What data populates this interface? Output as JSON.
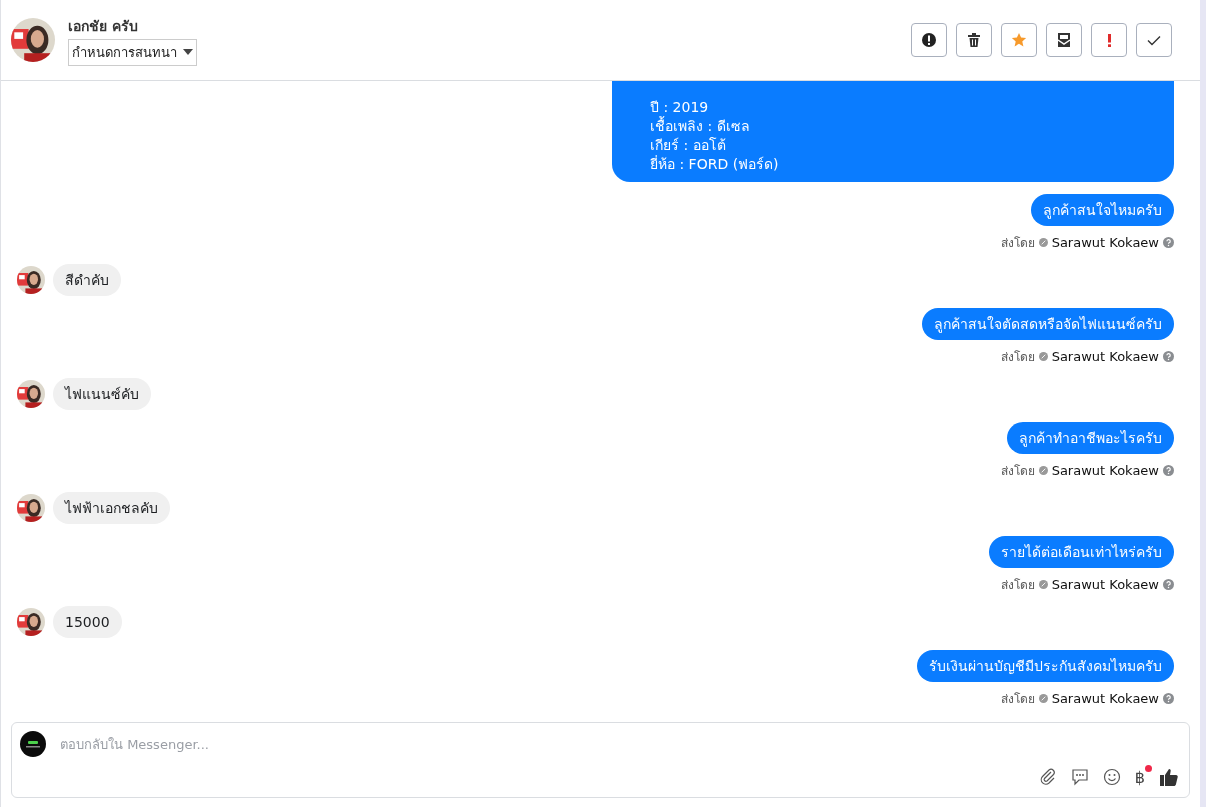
{
  "header": {
    "contact_name": "เอกชัย ครับ",
    "assign_dropdown": "กำหนดการสนทนา"
  },
  "messages": [
    {
      "kind": "outgoing",
      "lines": [
        "ปี : 2019",
        "เชื้อเพลิง : ดีเซล",
        "เกียร์ : ออโต้",
        "ยี่ห้อ : FORD (ฟอร์ด)"
      ]
    },
    {
      "kind": "outgoing",
      "text": "ลูกค้าสนใจไหมครับ",
      "sent_by_label": "ส่งโดย",
      "sender": "Sarawut Kokaew"
    },
    {
      "kind": "incoming",
      "text": "สีดำคับ"
    },
    {
      "kind": "outgoing",
      "text": "ลูกค้าสนใจตัดสดหรือจัดไฟแนนซ์ครับ",
      "sent_by_label": "ส่งโดย",
      "sender": "Sarawut Kokaew"
    },
    {
      "kind": "incoming",
      "text": "ไฟแนนซ์คับ"
    },
    {
      "kind": "outgoing",
      "text": "ลูกค้าทำอาชีพอะไรครับ",
      "sent_by_label": "ส่งโดย",
      "sender": "Sarawut Kokaew"
    },
    {
      "kind": "incoming",
      "text": "ไฟฟ้าเอกชลคับ"
    },
    {
      "kind": "outgoing",
      "text": "รายได้ต่อเดือนเท่าไหร่ครับ",
      "sent_by_label": "ส่งโดย",
      "sender": "Sarawut Kokaew"
    },
    {
      "kind": "incoming",
      "text": "15000"
    },
    {
      "kind": "outgoing",
      "text": "รับเงินผ่านบัญชีมีประกันสังคมไหมครับ",
      "sent_by_label": "ส่งโดย",
      "sender": "Sarawut Kokaew"
    }
  ],
  "composer": {
    "placeholder": "ตอบกลับใน Messenger...",
    "currency_symbol": "฿"
  }
}
